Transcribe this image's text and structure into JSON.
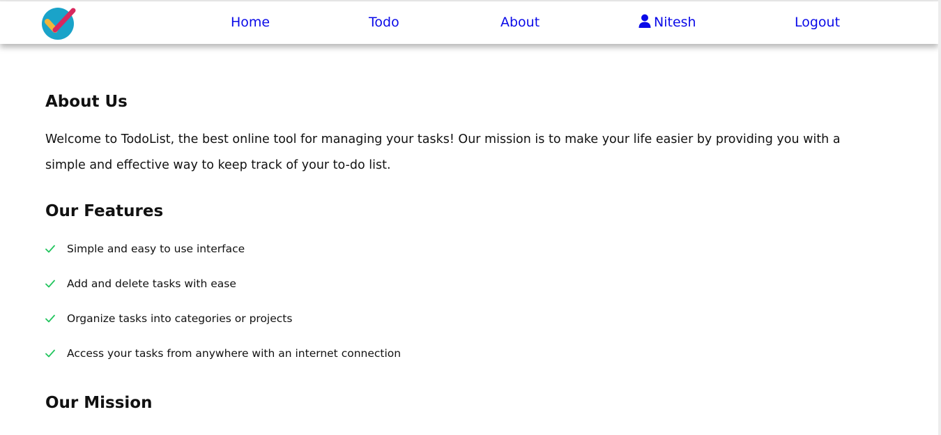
{
  "app": {
    "logo_icon": "checkmark-logo-icon"
  },
  "nav": {
    "home": "Home",
    "todo": "Todo",
    "about": "About",
    "user_icon": "user-icon",
    "user": "Nitesh",
    "logout": "Logout"
  },
  "colors": {
    "nav_link": "#0a0ae8",
    "check": "#22c55e",
    "logo_circle": "#1aa3c9",
    "logo_check_a": "#f2b53a",
    "logo_check_b": "#d9285e"
  },
  "about": {
    "heading": "About Us",
    "text": "Welcome to TodoList, the best online tool for managing your tasks! Our mission is to make your life easier by providing you with a simple and effective way to keep track of your to-do list."
  },
  "features": {
    "heading": "Our Features",
    "icon": "check-icon",
    "items": [
      "Simple and easy to use interface",
      "Add and delete tasks with ease",
      "Organize tasks into categories or projects",
      "Access your tasks from anywhere with an internet connection"
    ]
  },
  "mission": {
    "heading": "Our Mission"
  }
}
